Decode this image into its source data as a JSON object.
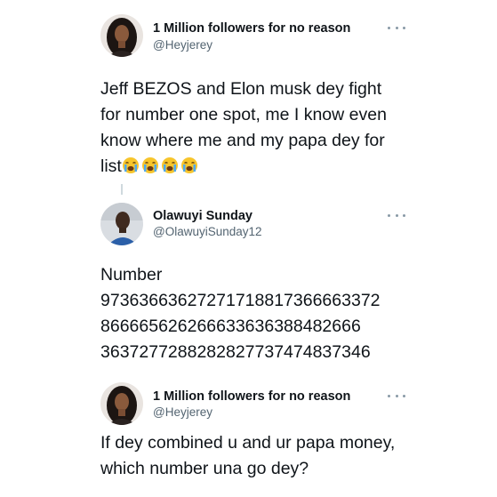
{
  "tweets": [
    {
      "author_name": "1 Million followers for no reason",
      "handle": "@Heyjerey",
      "text": "Jeff BEZOS and Elon musk dey fight\nfor number one spot, me I know even\nknow where me and my papa dey for\nlist",
      "trailing_emoji": [
        "loudly-crying-face",
        "loudly-crying-face",
        "loudly-crying-face",
        "loudly-crying-face"
      ]
    },
    {
      "author_name": "Olawuyi Sunday",
      "handle": "@OlawuyiSunday12",
      "text": "Number\n97363663627271718817366663372\n86666562626663363638848​2666\n36372772882828277374748373​46"
    },
    {
      "author_name": "1 Million followers for no reason",
      "handle": "@Heyjerey",
      "text": "If dey combined u and ur papa money,\nwhich number una go dey?"
    }
  ],
  "colors": {
    "text": "#0f1419",
    "secondary": "#536471",
    "thread_line": "#cfd9de",
    "more_dots": "#8899a6"
  }
}
